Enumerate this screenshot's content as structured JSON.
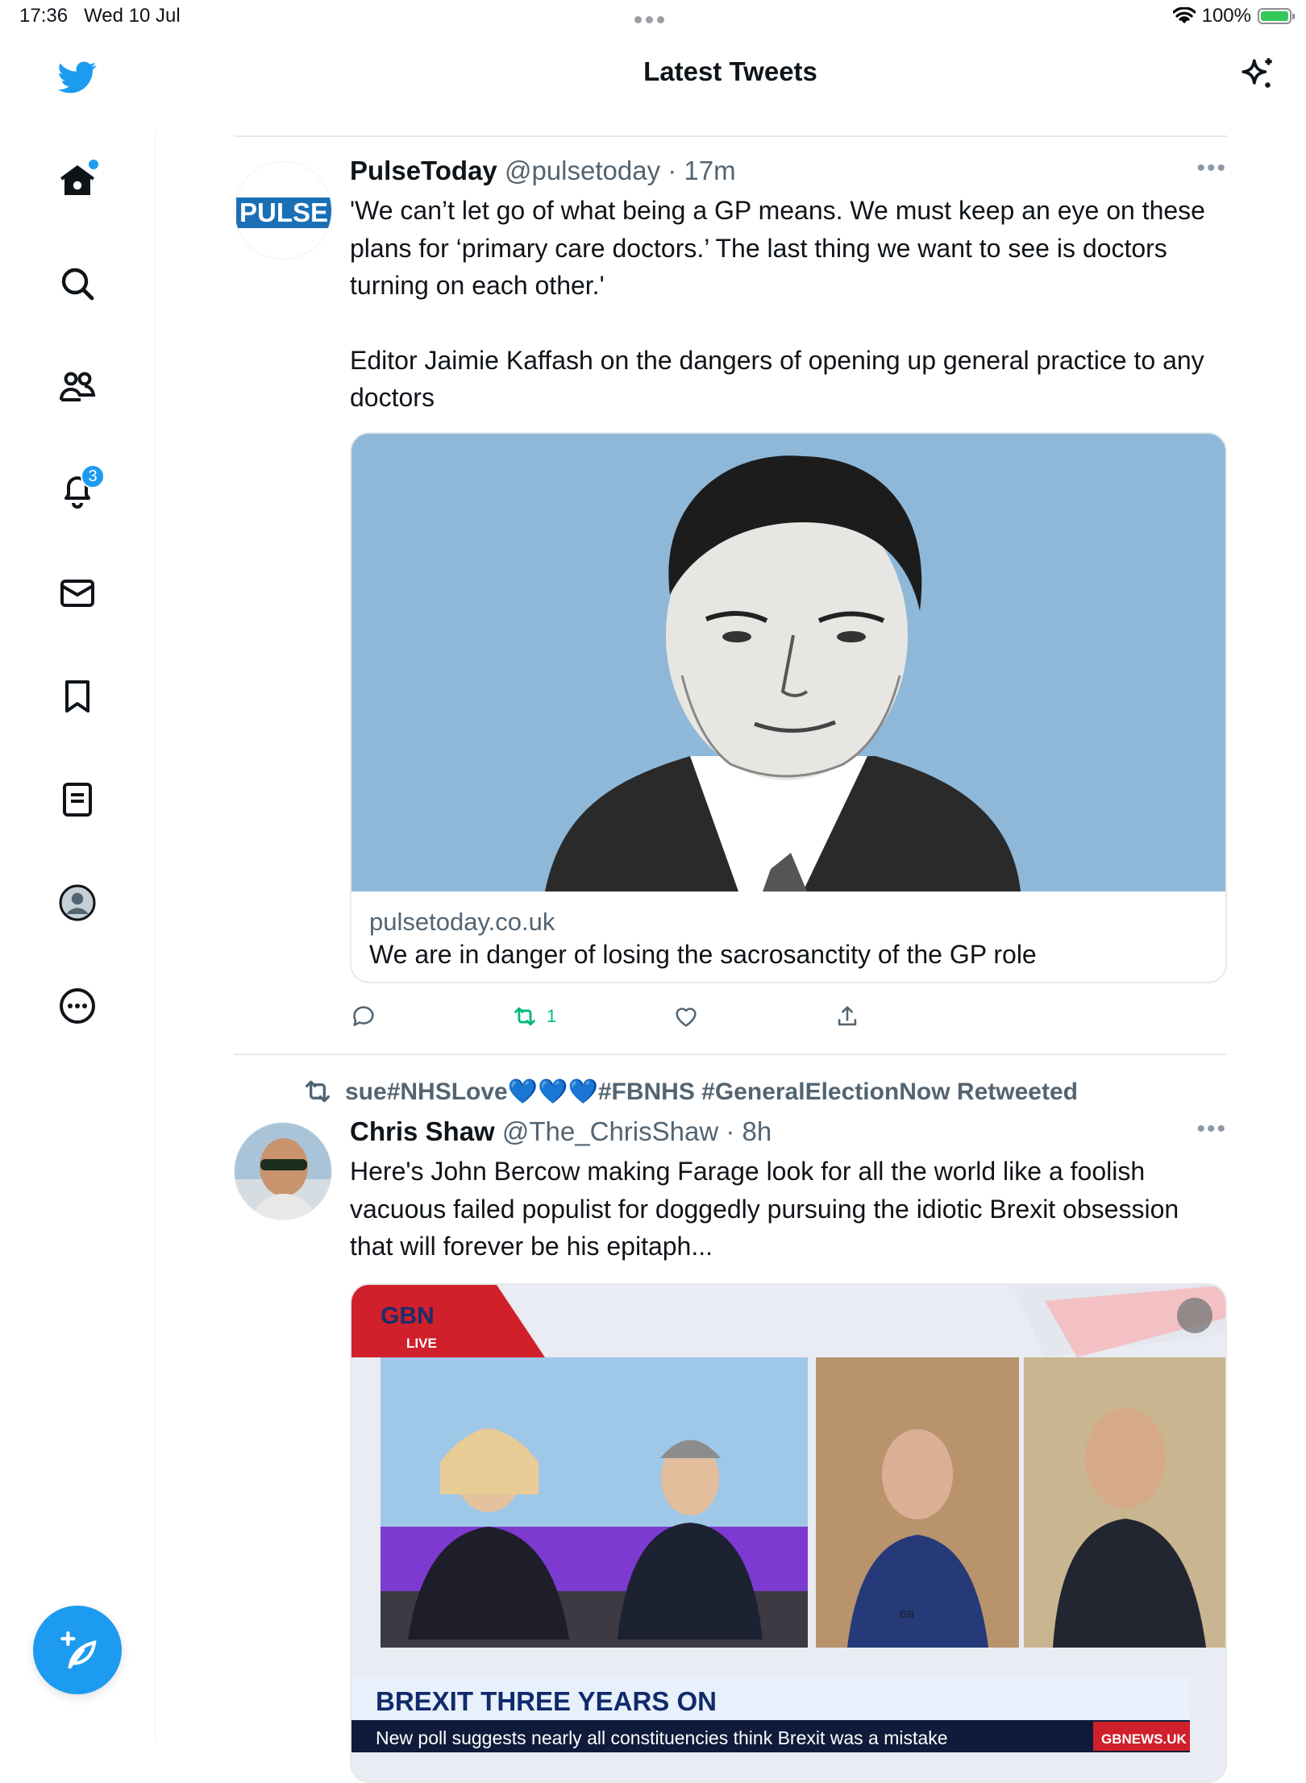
{
  "status_bar": {
    "time": "17:36",
    "date": "Wed 10 Jul",
    "battery": "100%",
    "battery_level": 1.0
  },
  "colors": {
    "accent": "#1d9bf0",
    "retweet_green": "#00ba7c",
    "muted": "#536471"
  },
  "sidebar": {
    "items": [
      {
        "name": "twitter-logo-icon"
      },
      {
        "name": "home-icon"
      },
      {
        "name": "search-icon"
      },
      {
        "name": "communities-icon"
      },
      {
        "name": "notifications-icon",
        "badge": "3"
      },
      {
        "name": "messages-icon"
      },
      {
        "name": "bookmarks-icon"
      },
      {
        "name": "lists-icon"
      },
      {
        "name": "profile-icon"
      },
      {
        "name": "more-icon"
      }
    ],
    "compose_icon": "compose-icon"
  },
  "header": {
    "title": "Latest Tweets",
    "sparkle_icon": "sparkle-icon"
  },
  "tweets": [
    {
      "name": "PulseToday",
      "handle": "@pulsetoday",
      "time": "· 17m",
      "avatar_text": "PULSE",
      "text_1": "'We can’t let go of what being a GP means. We must keep an eye on these plans for ‘primary care doctors.’ The last thing we want to see is doctors turning on each other.'",
      "text_2": "Editor Jaimie Kaffash on the dangers of opening up general practice to any doctors",
      "card": {
        "domain": "pulsetoday.co.uk",
        "title": "We are in danger of losing the sacrosanctity of the GP role"
      },
      "retweets": "1"
    },
    {
      "retweeted_by_prefix": "sue#NHSLove",
      "retweeted_by_hearts": "💙💙💙",
      "retweeted_by_suffix": "#FBNHS #GeneralElectionNow Retweeted",
      "name": "Chris Shaw",
      "handle": "@The_ChrisShaw",
      "time": "· 8h",
      "text": "Here's John Bercow making Farage look for all the world like a foolish vacuous failed populist for doggedly pursuing the idiotic Brexit obsession that will forever be his epitaph...",
      "media": {
        "channel": "GBN",
        "live": "LIVE",
        "headline": "BREXIT THREE YEARS ON",
        "ticker": "New poll suggests nearly all constituencies think Brexit was a mistake",
        "site": "GBNEWS.UK",
        "mug": "GB"
      }
    }
  ]
}
